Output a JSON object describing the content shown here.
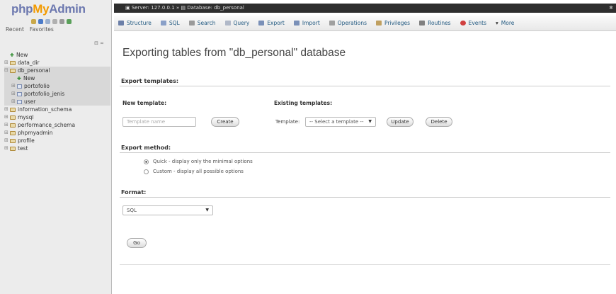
{
  "sidebar": {
    "logo": {
      "php": "php",
      "my": "My",
      "admin": "Admin"
    },
    "quick_icons": [
      "home-icon",
      "logout-icon",
      "docs-icon",
      "sql-docs-icon",
      "settings-icon",
      "reload-icon"
    ],
    "recent_label": "Recent",
    "favorites_label": "Favorites",
    "collapse_label": "⊟ ∞",
    "tree": [
      {
        "label": "New",
        "level": 1,
        "kind": "new"
      },
      {
        "label": "data_dir",
        "level": 0,
        "kind": "db"
      },
      {
        "label": "db_personal",
        "level": 0,
        "kind": "db",
        "expanded": true
      },
      {
        "label": "New",
        "level": 2,
        "kind": "new"
      },
      {
        "label": "portofolio",
        "level": 1,
        "kind": "table"
      },
      {
        "label": "portofolio_jenis",
        "level": 1,
        "kind": "table"
      },
      {
        "label": "user",
        "level": 1,
        "kind": "table"
      },
      {
        "label": "information_schema",
        "level": 0,
        "kind": "db"
      },
      {
        "label": "mysql",
        "level": 0,
        "kind": "db"
      },
      {
        "label": "performance_schema",
        "level": 0,
        "kind": "db"
      },
      {
        "label": "phpmyadmin",
        "level": 0,
        "kind": "db"
      },
      {
        "label": "profile",
        "level": 0,
        "kind": "db"
      },
      {
        "label": "test",
        "level": 0,
        "kind": "db"
      }
    ]
  },
  "breadcrumb": {
    "server": "Server: 127.0.0.1",
    "separator": "»",
    "database": "Database: db_personal"
  },
  "tabs": [
    {
      "label": "Structure",
      "icon": "structure-icon",
      "color": "#6b7fa8"
    },
    {
      "label": "SQL",
      "icon": "sql-icon",
      "color": "#8aa0c8"
    },
    {
      "label": "Search",
      "icon": "search-icon",
      "color": "#9a9a9a"
    },
    {
      "label": "Query",
      "icon": "query-icon",
      "color": "#b0b8c8"
    },
    {
      "label": "Export",
      "icon": "export-icon",
      "color": "#7a90b8"
    },
    {
      "label": "Import",
      "icon": "import-icon",
      "color": "#7a90b8"
    },
    {
      "label": "Operations",
      "icon": "wrench-icon",
      "color": "#a0a0a0"
    },
    {
      "label": "Privileges",
      "icon": "privileges-icon",
      "color": "#c0a060"
    },
    {
      "label": "Routines",
      "icon": "routines-icon",
      "color": "#808080"
    },
    {
      "label": "Events",
      "icon": "clock-icon",
      "color": "#d04040"
    },
    {
      "label": "More",
      "icon": "caret-down-icon",
      "color": "#333333"
    }
  ],
  "main": {
    "title": "Exporting tables from \"db_personal\" database",
    "templates": {
      "heading": "Export templates:",
      "new_label": "New template:",
      "name_placeholder": "Template name",
      "create_button": "Create",
      "existing_label": "Existing templates:",
      "template_label": "Template:",
      "select_value": "-- Select a template --",
      "update_button": "Update",
      "delete_button": "Delete"
    },
    "method": {
      "heading": "Export method:",
      "options": [
        {
          "label": "Quick - display only the minimal options",
          "selected": true
        },
        {
          "label": "Custom - display all possible options",
          "selected": false
        }
      ]
    },
    "format": {
      "heading": "Format:",
      "value": "SQL"
    },
    "go_button": "Go"
  }
}
